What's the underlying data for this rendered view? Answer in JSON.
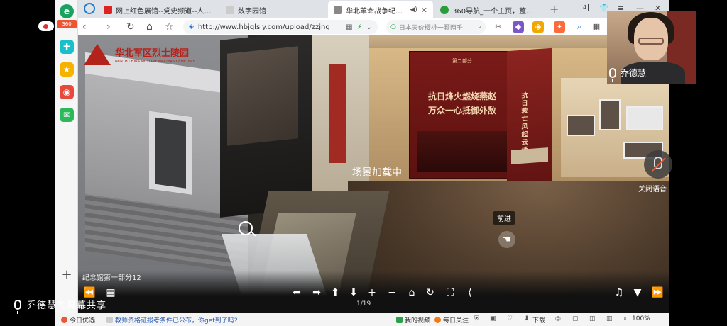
{
  "sidebar_badge": "360",
  "tabs": [
    {
      "title": "网上红色展馆--党史频道--人民网",
      "favicon_color": "#d22"
    },
    {
      "title": "数字园馆",
      "favicon_color": "#ccc"
    },
    {
      "title": "华北革命战争纪念馆",
      "favicon_color": "#888"
    },
    {
      "title": "360导航_一个主页，整个世界",
      "favicon_color": "#2a9d3a"
    }
  ],
  "toolbar": {
    "url_prefix": "http://",
    "url": "www.hbjqlsly.com/upload/zzjng",
    "search_placeholder": "日本天价樱桃一颗两千",
    "tab_count": "4"
  },
  "panorama": {
    "logo_title": "华北军区烈士陵园",
    "logo_subtitle": "NORTH CHINA MILITARY MARTYRS CEMETERY",
    "banner_small": "第二部分",
    "banner_line1": "抗日烽火燃烧燕赵",
    "banner_line2": "万众一心抵御外敌",
    "banner2_text": "抗日救亡 风起云涌",
    "loading_text": "场景加载中",
    "forward_hint": "前进",
    "scene_label": "纪念馆第一部分12",
    "page_indicator": "1/19"
  },
  "statusbar": {
    "today": "今日优选",
    "news": "教师资格证报考条件已公布，你get到了吗?",
    "my_video": "我的视频",
    "daily": "每日关注",
    "download": "下载",
    "zoom": "100%"
  },
  "overlay": {
    "presenter_share_label": "乔德慧的屏幕共享",
    "camera_name": "乔德慧",
    "mute_label": "关闭语音"
  },
  "colors": {
    "museum_red": "#b3231c",
    "banner_red": "#7a1a18",
    "browser_tabstrip": "#dfe3e8"
  }
}
